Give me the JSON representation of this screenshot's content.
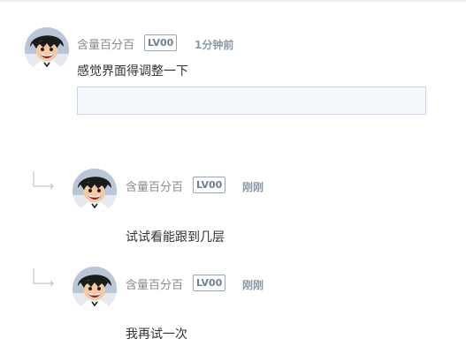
{
  "comments": [
    {
      "username": "含量百分百",
      "level": "LV00",
      "time": "1分钟前",
      "content": "感觉界面得调整一下",
      "avatar_icon": "anime-avatar-icon"
    }
  ],
  "reply_input": {
    "value": "",
    "placeholder": ""
  },
  "replies": [
    {
      "username": "含量百分百",
      "level": "LV00",
      "time": "刚刚",
      "content": "试试看能跟到几层",
      "avatar_icon": "anime-avatar-icon",
      "indicator_icon": "reply-arrow-icon"
    },
    {
      "username": "含量百分百",
      "level": "LV00",
      "time": "刚刚",
      "content": "我再试一次",
      "avatar_icon": "anime-avatar-icon",
      "indicator_icon": "reply-arrow-icon"
    }
  ],
  "colors": {
    "username": "#8b8b8b",
    "badge_border": "#9aa5b1",
    "time": "#8c99a7",
    "content": "#333333",
    "input_border": "#c7d6e6",
    "input_bg": "#f5f9fd"
  }
}
